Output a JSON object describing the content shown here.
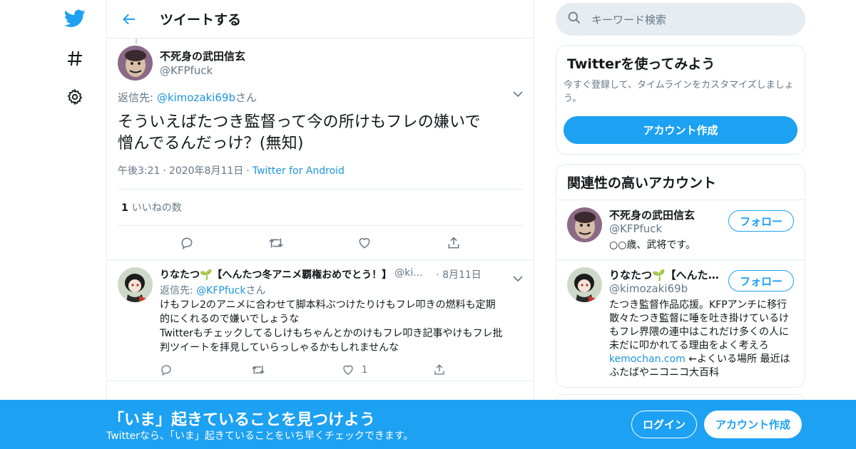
{
  "header": {
    "title": "ツイートする"
  },
  "tweet": {
    "author_name": "不死身の武田信玄",
    "author_handle": "@KFPfuck",
    "reply_prefix": "返信先: ",
    "reply_handle": "@kimozaki69b",
    "reply_suffix": "さん",
    "text_line1": "そういえばたつき監督って今の所けもフレの嫌いで",
    "text_line2": "憎んでるんだっけ？(無知)",
    "time": "午後3:21",
    "date": "2020年8月11日",
    "source": "Twitter for Android",
    "sep": "·",
    "likes_count": "1",
    "likes_label": "いいねの数"
  },
  "reply": {
    "name": "りなたつ🌱【へんたつ冬アニメ覇権おめでとう！】",
    "handle": "@kimozaki69b",
    "handle_short": "@ki...",
    "date": "8月11日",
    "reply_prefix": "返信先: ",
    "reply_handle": "@KFPfuck",
    "reply_suffix": "さん",
    "line1": "けもフレ2のアニメに合わせて脚本料ぶつけたりけもフレ叩きの燃料も定期",
    "line2": "的にくれるので嫌いでしょうな",
    "line3": "Twitterもチェックしてるしけもちゃんとかのけもフレ叩き記事やけもフレ批",
    "line4": "判ツイートを拝見していらっしゃるかもしれませんな",
    "like_count": "1"
  },
  "search": {
    "placeholder": "キーワード検索"
  },
  "signup_card": {
    "title": "Twitterを使ってみよう",
    "desc": "今すぐ登録して、タイムラインをカスタマイズしましょう。",
    "button": "アカウント作成"
  },
  "related": {
    "title": "関連性の高いアカウント",
    "follow_label": "フォロー",
    "accounts": [
      {
        "name": "不死身の武田信玄",
        "handle": "@KFPfuck",
        "bio": "○○歳、武将です。"
      },
      {
        "name": "りなたつ🌱【へんた...",
        "handle": "@kimozaki69b",
        "bio_before": "たつき監督作品応援。KFPアンチに移行 散々たつき監督に唾を吐き掛けているけもフレ界隈の連中はこれだけ多くの人に未だに叩かれてる理由をよく考えろ ",
        "bio_link": "kemochan.com",
        "bio_after": " ←よくいる場所 最近はふたばやニコニコ大百科"
      }
    ]
  },
  "bottom_bar": {
    "title": "「いま」起きていることを見つけよう",
    "subtitle": "Twitterなら、「いま」起きていることをいち早くチェックできます。",
    "login": "ログイン",
    "signup": "アカウント作成"
  },
  "colors": {
    "accent": "#1da1f2",
    "link": "#1b95e0",
    "muted": "#657786",
    "border": "#e6ecf0"
  }
}
